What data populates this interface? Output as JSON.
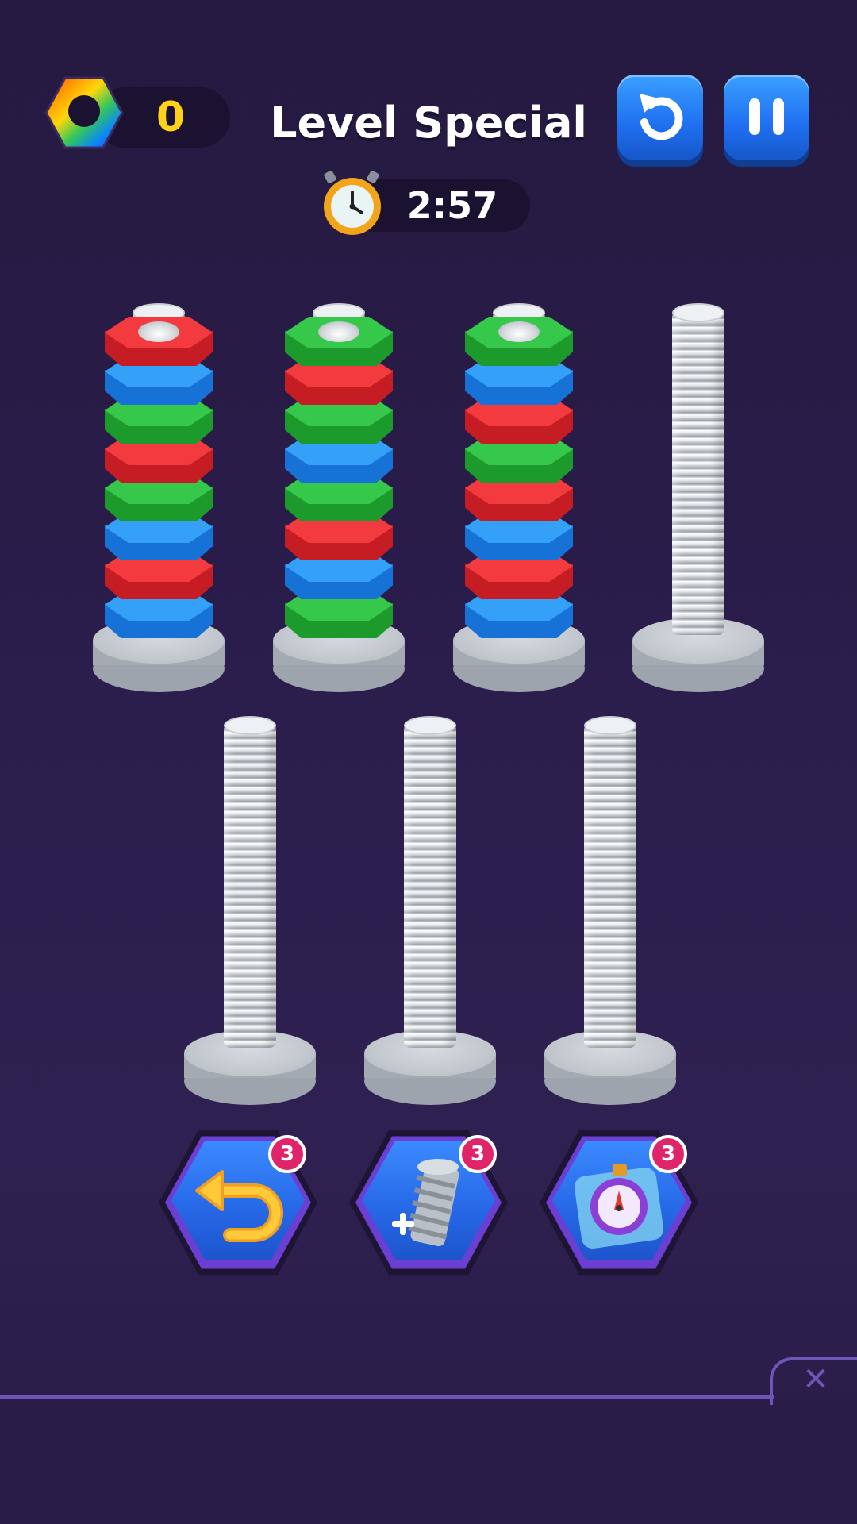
{
  "hud": {
    "coins": "0",
    "level_title": "Level Special",
    "timer": "2:57",
    "restart_icon": "restart-icon",
    "pause_icon": "pause-icon",
    "coin_icon": "rainbow-hex-nut-icon",
    "clock_icon": "alarm-clock-icon"
  },
  "colors": {
    "red": "#e8242c",
    "blue": "#1f8ef0",
    "green": "#27b53a",
    "accent": "#ffd21a"
  },
  "screws": [
    {
      "id": 1,
      "nuts_top_to_bottom": [
        "red",
        "blue",
        "green",
        "red",
        "green",
        "blue",
        "red",
        "blue"
      ]
    },
    {
      "id": 2,
      "nuts_top_to_bottom": [
        "green",
        "red",
        "green",
        "blue",
        "green",
        "red",
        "blue",
        "green"
      ]
    },
    {
      "id": 3,
      "nuts_top_to_bottom": [
        "green",
        "blue",
        "red",
        "green",
        "red",
        "blue",
        "red",
        "blue"
      ]
    },
    {
      "id": 4,
      "nuts_top_to_bottom": []
    },
    {
      "id": 5,
      "nuts_top_to_bottom": []
    },
    {
      "id": 6,
      "nuts_top_to_bottom": []
    },
    {
      "id": 7,
      "nuts_top_to_bottom": []
    }
  ],
  "powerups": [
    {
      "name": "undo",
      "icon": "undo-arrow-icon",
      "count": "3"
    },
    {
      "name": "add-screw",
      "icon": "add-screw-icon",
      "count": "3"
    },
    {
      "name": "freeze-time",
      "icon": "stopwatch-icon",
      "count": "3"
    }
  ],
  "banner": {
    "close_label": "✕"
  }
}
